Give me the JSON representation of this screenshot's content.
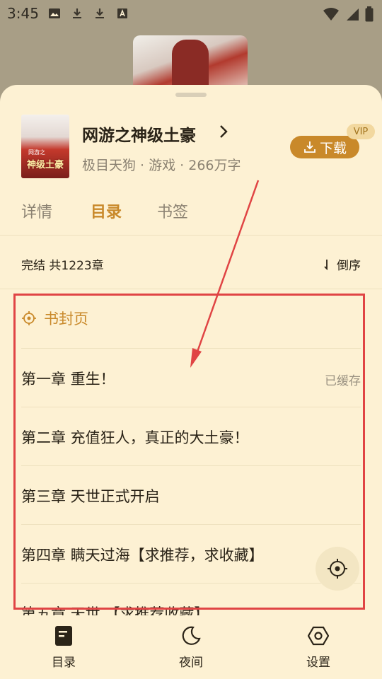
{
  "status_bar": {
    "time": "3:45",
    "icons": [
      "image-icon",
      "download-icon",
      "download-icon",
      "font-icon",
      "wifi-icon",
      "signal-icon",
      "battery-icon"
    ]
  },
  "book": {
    "cover_text": "神级土豪",
    "cover_subtitle": "网游之",
    "title": "网游之神级土豪",
    "meta": "极目天狗 · 游戏 · 266万字",
    "download_label": "下载",
    "vip_label": "VIP"
  },
  "tabs": [
    {
      "label": "详情",
      "active": false
    },
    {
      "label": "目录",
      "active": true
    },
    {
      "label": "书签",
      "active": false
    }
  ],
  "catalog": {
    "summary": "完结 共1223章",
    "sort_label": "倒序",
    "cover_page_label": "书封页",
    "chapters": [
      {
        "title": "第一章 重生！",
        "status": "已缓存"
      },
      {
        "title": "第二章 充值狂人，真正的大土豪！",
        "status": ""
      },
      {
        "title": "第三章 天世正式开启",
        "status": ""
      },
      {
        "title": "第四章 瞒天过海【求推荐，求收藏】",
        "status": ""
      },
      {
        "title": "第五章 天世 【求推荐收藏】",
        "status": ""
      }
    ]
  },
  "bottom_nav": [
    {
      "label": "目录",
      "icon": "book-icon"
    },
    {
      "label": "夜间",
      "icon": "moon-icon"
    },
    {
      "label": "设置",
      "icon": "settings-icon"
    }
  ],
  "colors": {
    "accent": "#c9892a",
    "sheet_bg": "#fdf1d3",
    "text": "#2b2418",
    "secondary_text": "#8b8272",
    "annotation": "#e04444"
  }
}
